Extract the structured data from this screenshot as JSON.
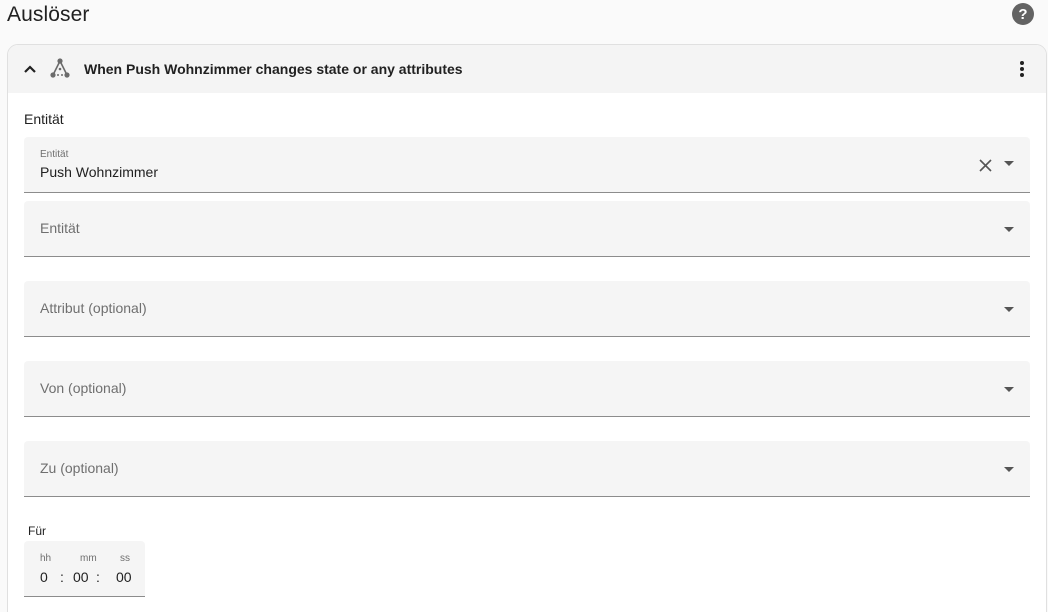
{
  "page": {
    "title": "Auslöser",
    "help_glyph": "?"
  },
  "trigger": {
    "header_title": "When Push Wohnzimmer changes state or any attributes",
    "section_label": "Entität",
    "entity_field": {
      "label": "Entität",
      "value": "Push Wohnzimmer"
    },
    "entity_field_2": {
      "placeholder": "Entität"
    },
    "attribute_field": {
      "placeholder": "Attribut (optional)"
    },
    "from_field": {
      "placeholder": "Von (optional)"
    },
    "to_field": {
      "placeholder": "Zu (optional)"
    },
    "duration": {
      "label": "Für",
      "hours_label": "hh",
      "minutes_label": "mm",
      "seconds_label": "ss",
      "hours": "0",
      "minutes": "00",
      "seconds": "00",
      "separator": ":"
    }
  },
  "icons": {
    "help": "help-circle-icon",
    "collapse": "chevron-up-icon",
    "trigger_type": "state-trigger-icon",
    "menu": "dots-vertical-icon",
    "clear": "close-icon",
    "dropdown": "menu-down-icon"
  },
  "colors": {
    "header_bg": "#f4f4f4",
    "field_bg": "#f5f5f5",
    "icon_gray": "#636363"
  }
}
